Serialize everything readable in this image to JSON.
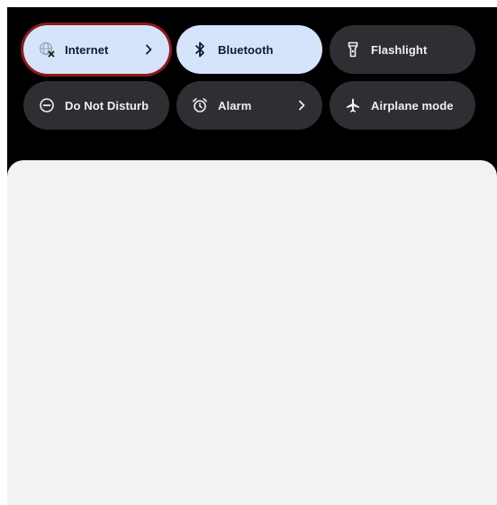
{
  "quick_settings": {
    "tiles": [
      {
        "label": "Internet",
        "icon": "internet-off-icon",
        "state": "on",
        "has_chevron": true
      },
      {
        "label": "Bluetooth",
        "icon": "bluetooth-icon",
        "state": "on",
        "has_chevron": false
      },
      {
        "label": "Flashlight",
        "icon": "flashlight-icon",
        "state": "off",
        "has_chevron": false
      },
      {
        "label": "Do Not Disturb",
        "icon": "do-not-disturb-icon",
        "state": "off",
        "has_chevron": false
      },
      {
        "label": "Alarm",
        "icon": "alarm-icon",
        "state": "off",
        "has_chevron": true
      },
      {
        "label": "Airplane mode",
        "icon": "airplane-icon",
        "state": "off",
        "has_chevron": false
      }
    ]
  },
  "colors": {
    "panel_background": "#000000",
    "tile_active": "#d6e4fb",
    "tile_inactive": "#2d2f33",
    "highlight_outline": "#8b1a1a",
    "sheet_background": "#f2f2f5"
  }
}
